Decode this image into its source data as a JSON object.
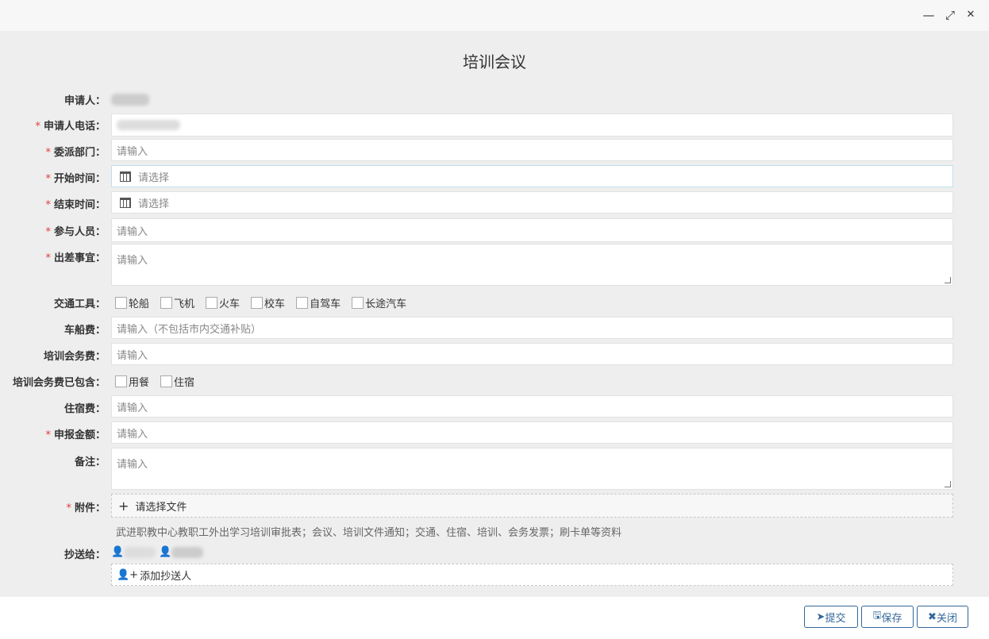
{
  "window": {
    "minimize": "—",
    "maximize": "⤢",
    "close": "✕"
  },
  "title": "培训会议",
  "fields": {
    "applicant": {
      "label": "申请人："
    },
    "phone": {
      "label": "申请人电话："
    },
    "dept": {
      "label": "委派部门：",
      "placeholder": "请输入"
    },
    "start": {
      "label": "开始时间：",
      "placeholder": "请选择"
    },
    "end": {
      "label": "结束时间：",
      "placeholder": "请选择"
    },
    "participants": {
      "label": "参与人员：",
      "placeholder": "请输入"
    },
    "matter": {
      "label": "出差事宜：",
      "placeholder": "请输入"
    },
    "transport": {
      "label": "交通工具：",
      "options": [
        "轮船",
        "飞机",
        "火车",
        "校车",
        "自驾车",
        "长途汽车"
      ]
    },
    "fare": {
      "label": "车船费：",
      "placeholder": "请输入（不包括市内交通补贴）"
    },
    "fee": {
      "label": "培训会务费：",
      "placeholder": "请输入"
    },
    "included": {
      "label": "培训会务费已包含：",
      "options": [
        "用餐",
        "住宿"
      ]
    },
    "lodging": {
      "label": "住宿费：",
      "placeholder": "请输入"
    },
    "amount": {
      "label": "申报金额：",
      "placeholder": "请输入"
    },
    "remark": {
      "label": "备注：",
      "placeholder": "请输入"
    },
    "attachment": {
      "label": "附件：",
      "button": "请选择文件",
      "hint": "武进职教中心教职工外出学习培训审批表；会议、培训文件通知；交通、住宿、培训、会务发票；刷卡单等资料"
    },
    "cc": {
      "label": "抄送给：",
      "add": "添加抄送人"
    }
  },
  "required_mark": "*",
  "buttons": {
    "submit": "提交",
    "save": "保存",
    "close": "关闭"
  }
}
